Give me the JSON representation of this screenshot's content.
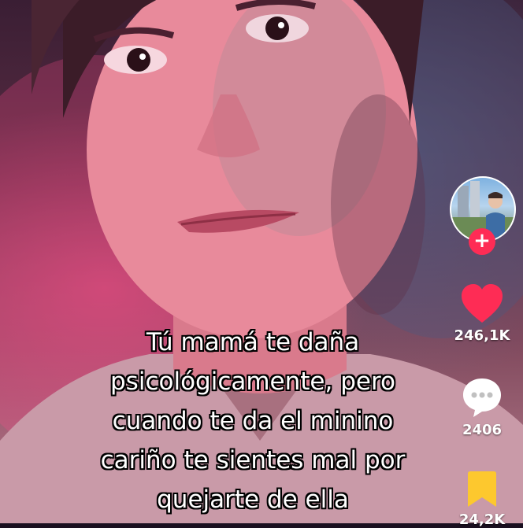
{
  "video": {
    "caption_lines": [
      "Tú mamá te daña",
      "psicológicamente, pero",
      "cuando te da el minino",
      "cariño te sientes mal por",
      "quejarte de ella"
    ]
  },
  "sidebar": {
    "avatar_icon": "profile-avatar",
    "follow_icon": "plus-icon",
    "follow_symbol": "+",
    "like": {
      "icon": "heart-icon",
      "count": "246,1K",
      "color": "#fe2c55"
    },
    "comment": {
      "icon": "comment-bubble-icon",
      "count": "2406",
      "color": "#ffffff"
    },
    "save": {
      "icon": "bookmark-icon",
      "count": "24,2K",
      "color": "#fdc82e"
    }
  },
  "colors": {
    "accent": "#fe2c55",
    "bookmark": "#fdc82e"
  }
}
